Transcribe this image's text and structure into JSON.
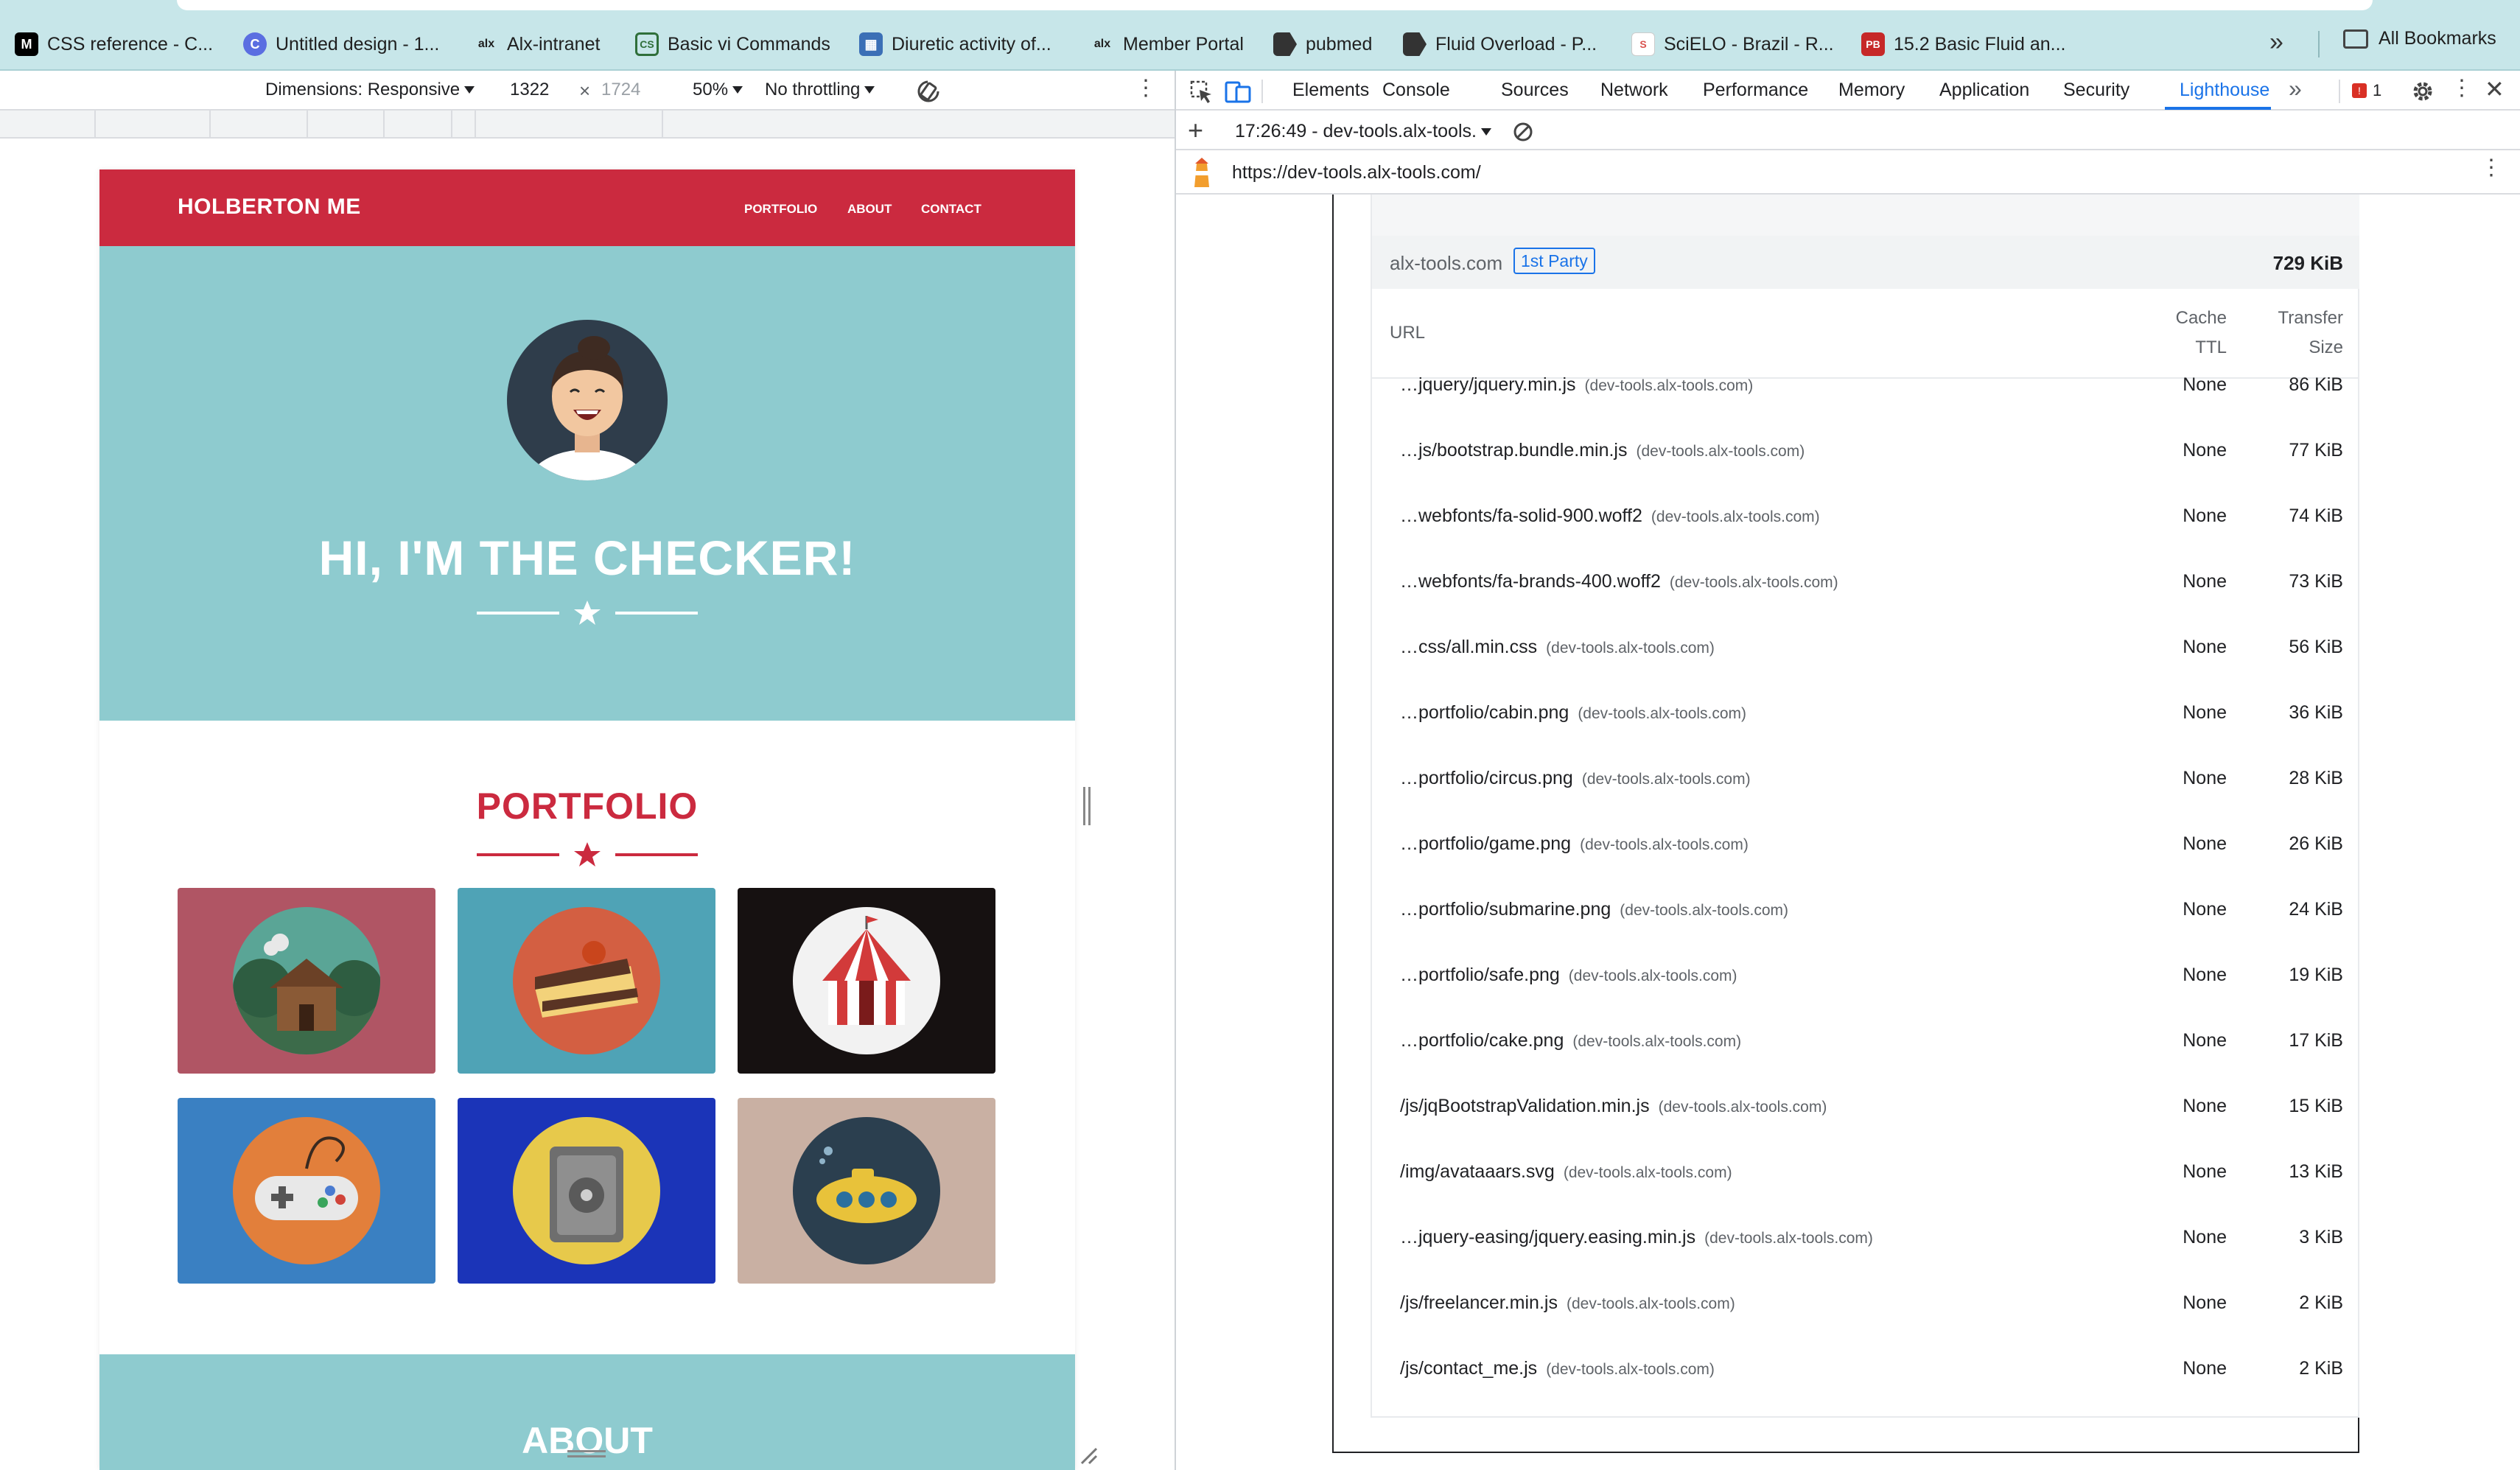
{
  "bookmarks": {
    "items": [
      {
        "label": "CSS reference - C...",
        "icon": "m-icon",
        "color": "#000000"
      },
      {
        "label": "Untitled design - 1...",
        "icon": "canva-icon",
        "color": "#5b6ee1"
      },
      {
        "label": "Alx-intranet",
        "icon": "alx-icon",
        "color": "#1f1f1f"
      },
      {
        "label": "Basic vi Commands",
        "icon": "cs-icon",
        "color": "#2f6f3a"
      },
      {
        "label": "Diuretic activity of...",
        "icon": "grid-icon",
        "color": "#3b6fb6"
      },
      {
        "label": "Member Portal",
        "icon": "alx-icon",
        "color": "#1f1f1f"
      },
      {
        "label": "pubmed",
        "icon": "bookmark-icon",
        "color": "#333333"
      },
      {
        "label": "Fluid Overload - P...",
        "icon": "bookmark-icon",
        "color": "#333333"
      },
      {
        "label": "SciELO - Brazil - R...",
        "icon": "scielo-icon",
        "color": "#d9534f"
      },
      {
        "label": "15.2 Basic Fluid an...",
        "icon": "pb-icon",
        "color": "#c62828"
      }
    ],
    "more": "»",
    "all_bookmarks": "All Bookmarks"
  },
  "device_toolbar": {
    "dimensions_label": "Dimensions: Responsive",
    "width": "1322",
    "height_placeholder": "1724",
    "times": "×",
    "zoom": "50%",
    "throttling": "No throttling"
  },
  "site": {
    "brand": "HOLBERTON ME",
    "nav": [
      "PORTFOLIO",
      "ABOUT",
      "CONTACT"
    ],
    "hero_title": "HI, I'M THE CHECKER!",
    "portfolio_title": "PORTFOLIO",
    "about_title": "ABOUT",
    "colors": {
      "red": "#cb2a3f",
      "teal": "#8ecbcf"
    },
    "tiles": [
      {
        "name": "cabin",
        "bg": "#b05564"
      },
      {
        "name": "cake",
        "bg": "#4fa3b6"
      },
      {
        "name": "circus",
        "bg": "#161111"
      },
      {
        "name": "game",
        "bg": "#3a80c2"
      },
      {
        "name": "safe",
        "bg": "#1b34b8"
      },
      {
        "name": "submarine",
        "bg": "#c9b0a3"
      }
    ]
  },
  "devtools": {
    "tabs": [
      "Elements",
      "Console",
      "Sources",
      "Network",
      "Performance",
      "Memory",
      "Application",
      "Security",
      "Lighthouse"
    ],
    "active_tab": "Lighthouse",
    "more_tabs": "»",
    "issues_count": "1",
    "report_selector": "17:26:49 - dev-tools.alx-tools.",
    "url": "https://dev-tools.alx-tools.com/"
  },
  "report": {
    "group": {
      "name": "alx-tools.com",
      "badge": "1st Party",
      "size": "729 KiB"
    },
    "columns": {
      "url": "URL",
      "ttl_1": "Cache",
      "ttl_2": "TTL",
      "size_1": "Transfer",
      "size_2": "Size"
    },
    "rows": [
      {
        "url": "…jquery/jquery.min.js",
        "host": "(dev-tools.alx-tools.com)",
        "ttl": "None",
        "size": "86 KiB"
      },
      {
        "url": "…js/bootstrap.bundle.min.js",
        "host": "(dev-tools.alx-tools.com)",
        "ttl": "None",
        "size": "77 KiB"
      },
      {
        "url": "…webfonts/fa-solid-900.woff2",
        "host": "(dev-tools.alx-tools.com)",
        "ttl": "None",
        "size": "74 KiB"
      },
      {
        "url": "…webfonts/fa-brands-400.woff2",
        "host": "(dev-tools.alx-tools.com)",
        "ttl": "None",
        "size": "73 KiB"
      },
      {
        "url": "…css/all.min.css",
        "host": "(dev-tools.alx-tools.com)",
        "ttl": "None",
        "size": "56 KiB"
      },
      {
        "url": "…portfolio/cabin.png",
        "host": "(dev-tools.alx-tools.com)",
        "ttl": "None",
        "size": "36 KiB"
      },
      {
        "url": "…portfolio/circus.png",
        "host": "(dev-tools.alx-tools.com)",
        "ttl": "None",
        "size": "28 KiB"
      },
      {
        "url": "…portfolio/game.png",
        "host": "(dev-tools.alx-tools.com)",
        "ttl": "None",
        "size": "26 KiB"
      },
      {
        "url": "…portfolio/submarine.png",
        "host": "(dev-tools.alx-tools.com)",
        "ttl": "None",
        "size": "24 KiB"
      },
      {
        "url": "…portfolio/safe.png",
        "host": "(dev-tools.alx-tools.com)",
        "ttl": "None",
        "size": "19 KiB"
      },
      {
        "url": "…portfolio/cake.png",
        "host": "(dev-tools.alx-tools.com)",
        "ttl": "None",
        "size": "17 KiB"
      },
      {
        "url": "/js/jqBootstrapValidation.min.js",
        "host": "(dev-tools.alx-tools.com)",
        "ttl": "None",
        "size": "15 KiB"
      },
      {
        "url": "/img/avataaars.svg",
        "host": "(dev-tools.alx-tools.com)",
        "ttl": "None",
        "size": "13 KiB"
      },
      {
        "url": "…jquery-easing/jquery.easing.min.js",
        "host": "(dev-tools.alx-tools.com)",
        "ttl": "None",
        "size": "3 KiB"
      },
      {
        "url": "/js/freelancer.min.js",
        "host": "(dev-tools.alx-tools.com)",
        "ttl": "None",
        "size": "2 KiB"
      },
      {
        "url": "/js/contact_me.js",
        "host": "(dev-tools.alx-tools.com)",
        "ttl": "None",
        "size": "2 KiB"
      }
    ]
  }
}
